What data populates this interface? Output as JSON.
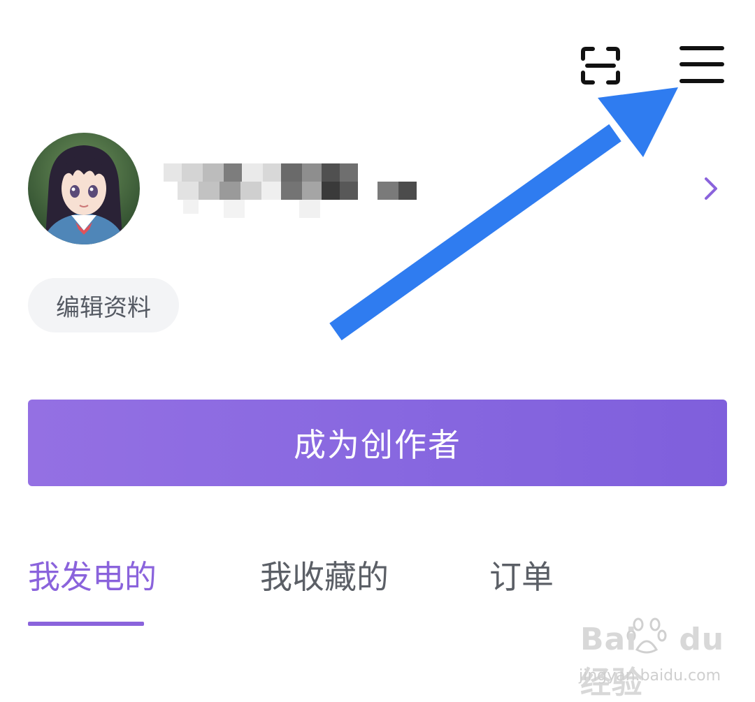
{
  "header": {
    "scan_icon": "scan-icon",
    "menu_icon": "hamburger-menu-icon"
  },
  "profile": {
    "avatar_icon": "anime-avatar",
    "username": "",
    "edit_label": "编辑资料",
    "chevron_icon": "chevron-right-icon"
  },
  "creator_button": {
    "label": "成为创作者",
    "color_start": "#9470e3",
    "color_end": "#7f5fdc"
  },
  "tabs": [
    {
      "label": "我发电的",
      "active": true
    },
    {
      "label": "我收藏的",
      "active": false
    },
    {
      "label": "订单",
      "active": false
    }
  ],
  "colors": {
    "accent": "#8a63dc",
    "annotation_arrow": "#2f7cf0"
  },
  "watermark": {
    "logo_text": "Bai",
    "logo_text2": "du",
    "logo_text3": "经验",
    "url": "jingyan.baidu.com"
  }
}
